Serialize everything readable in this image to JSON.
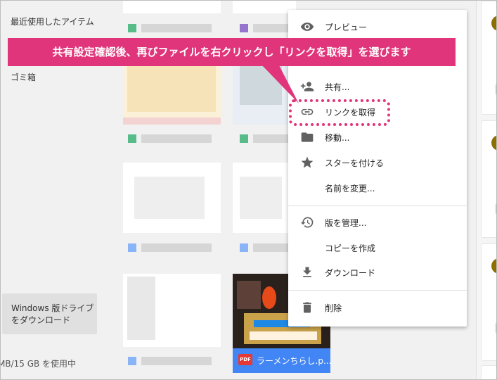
{
  "sidebar": {
    "recent": "最近使用したアイテム",
    "trash": "ゴミ箱",
    "windows_download": "Windows 版ドライブをダウンロード",
    "storage": "MB/15 GB を使用中"
  },
  "banner": {
    "text": "共有設定確認後、再びファイルを右クリックし「リンクを取得」を選びます",
    "color": "#e0357a"
  },
  "context_menu": {
    "items": [
      {
        "label": "プレビュー",
        "icon": "eye-icon"
      },
      {
        "label": "共有...",
        "icon": "person-add-icon"
      },
      {
        "label": "リンクを取得",
        "icon": "link-icon"
      },
      {
        "label": "移動...",
        "icon": "folder-icon"
      },
      {
        "label": "スターを付ける",
        "icon": "star-icon"
      },
      {
        "label": "名前を変更...",
        "icon": ""
      },
      {
        "label": "版を管理...",
        "icon": "history-icon"
      },
      {
        "label": "コピーを作成",
        "icon": ""
      },
      {
        "label": "ダウンロード",
        "icon": "download-icon"
      },
      {
        "label": "削除",
        "icon": "trash-icon"
      }
    ]
  },
  "file_tile": {
    "name": "ラーメンちらし.p...",
    "type_badge": "PDF",
    "accent": "#4285f4"
  }
}
